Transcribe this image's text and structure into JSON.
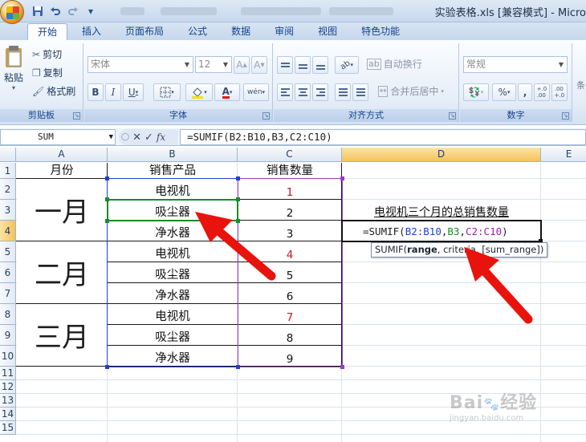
{
  "window": {
    "title": "实验表格.xls [兼容模式] - Micro",
    "office_button": "office-button",
    "qat_icons": [
      "save-icon",
      "undo-icon",
      "redo-icon",
      "customize-icon"
    ]
  },
  "tabs": [
    "开始",
    "插入",
    "页面布局",
    "公式",
    "数据",
    "审阅",
    "视图",
    "特色功能"
  ],
  "ribbon": {
    "clipboard": {
      "label": "剪贴板",
      "paste": "粘贴",
      "cut": "剪切",
      "copy": "复制",
      "format_painter": "格式刷"
    },
    "font": {
      "label": "字体",
      "font_name": "宋体",
      "font_size": "12",
      "bold": "B",
      "italic": "I",
      "underline": "U",
      "wen": "wén"
    },
    "alignment": {
      "label": "对齐方式",
      "wrap": "自动换行",
      "merge": "合并后居中"
    },
    "number": {
      "label": "数字",
      "format": "常规",
      "percent": "%",
      "comma": ",",
      "inc_dec": "+.0\n.00",
      "dec_dec": ".00\n+.0"
    },
    "styles": {
      "label_partial": "条"
    }
  },
  "formula_bar": {
    "name_box": "SUM",
    "cancel": "✕",
    "enter": "✓",
    "fx": "fx",
    "formula": "=SUMIF(B2:B10,B3,C2:C10)"
  },
  "columns": [
    "A",
    "B",
    "C",
    "D",
    "E"
  ],
  "rows": [
    "1",
    "2",
    "3",
    "4",
    "5",
    "6",
    "7",
    "8",
    "9",
    "10",
    "11",
    "12",
    "13",
    "14",
    "15"
  ],
  "sheet": {
    "headers": [
      "月份",
      "销售产品",
      "销售数量"
    ],
    "months": [
      "一月",
      "二月",
      "三月"
    ],
    "products": [
      "电视机",
      "吸尘器",
      "净水器",
      "电视机",
      "吸尘器",
      "净水器",
      "电视机",
      "吸尘器",
      "净水器"
    ],
    "quantities": [
      "1",
      "2",
      "3",
      "4",
      "5",
      "6",
      "7",
      "8",
      "9"
    ],
    "d3_text": "电视机三个月的总销售数量",
    "d4_formula_parts": [
      "=SUMIF(",
      "B2:B10",
      ",",
      "B3",
      ",",
      "C2:C10",
      ")"
    ]
  },
  "tooltip": {
    "fn": "SUMIF(",
    "arg1": "range",
    "rest": ", criteria, [sum_range])"
  },
  "colors": {
    "range_blue": "#1f3fd8",
    "criteria_green": "#1b8a2a",
    "sum_purple": "#8a1fa8",
    "red_arrow": "#e8130c"
  }
}
